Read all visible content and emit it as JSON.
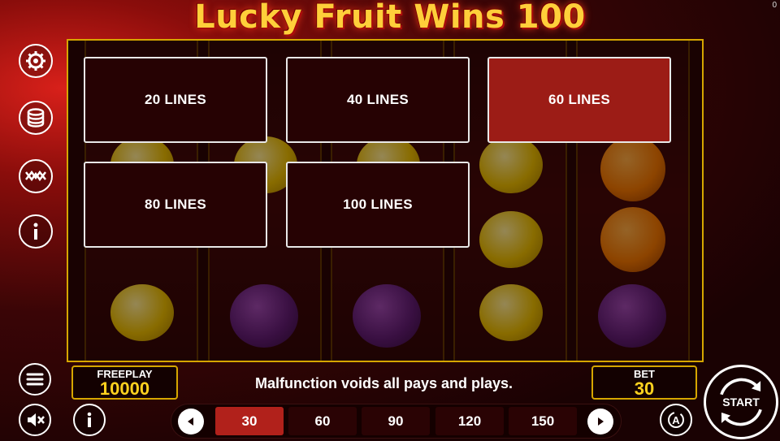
{
  "counter": "0",
  "title": "Lucky Fruit Wins 100",
  "sidebar": {
    "settings_icon": "gear-icon",
    "coins_icon": "coin-stack-icon",
    "paylines_icon": "paylines-icon",
    "info_icon": "info-icon"
  },
  "lines_menu": {
    "options": [
      "20 LINES",
      "40 LINES",
      "60 LINES",
      "80 LINES",
      "100 LINES"
    ],
    "selected": "60 LINES"
  },
  "freeplay": {
    "label": "FREEPLAY",
    "value": "10000"
  },
  "bet": {
    "label": "BET",
    "value": "30"
  },
  "notice": "Malfunction voids all pays and plays.",
  "bet_options": [
    "30",
    "60",
    "90",
    "120",
    "150"
  ],
  "bet_selected": "30",
  "start_label": "START",
  "colors": {
    "gold": "#ffd21f",
    "accent_red": "#b1211b",
    "frame": "#d6a600"
  }
}
